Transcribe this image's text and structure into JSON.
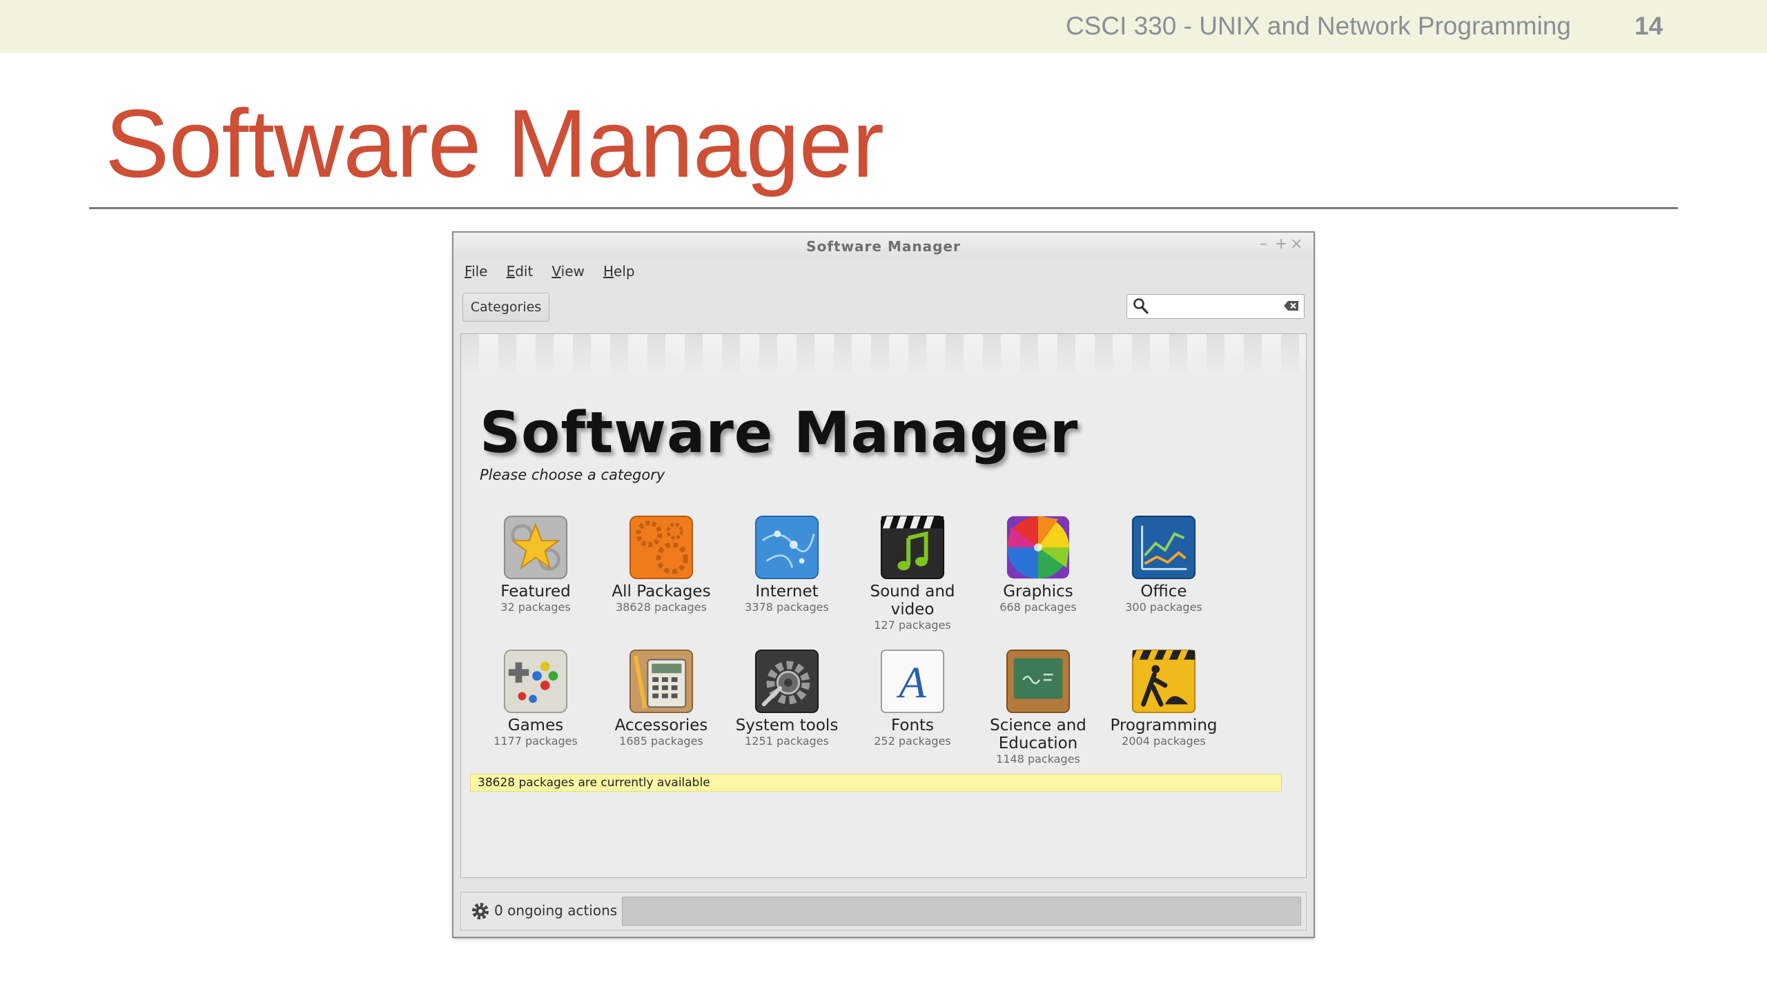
{
  "slide": {
    "course_title": "CSCI 330 - UNIX and Network Programming",
    "slide_number": "14",
    "title": "Software Manager"
  },
  "window": {
    "title": "Software Manager",
    "controls": {
      "minimize": "–",
      "maximize": "+",
      "close": "×"
    },
    "menu": [
      "File",
      "Edit",
      "View",
      "Help"
    ],
    "categories_button": "Categories",
    "search": {
      "value": "",
      "placeholder": ""
    }
  },
  "main": {
    "heading": "Software Manager",
    "subheading": "Please choose a category",
    "categories": [
      {
        "label": "Featured",
        "count": "32 packages",
        "icon": "featured-star-icon"
      },
      {
        "label": "All Packages",
        "count": "38628 packages",
        "icon": "all-packages-gears-icon"
      },
      {
        "label": "Internet",
        "count": "3378 packages",
        "icon": "internet-globe-icon"
      },
      {
        "label": "Sound and video",
        "count": "127 packages",
        "icon": "sound-video-clapper-icon"
      },
      {
        "label": "Graphics",
        "count": "668 packages",
        "icon": "graphics-color-wheel-icon"
      },
      {
        "label": "Office",
        "count": "300 packages",
        "icon": "office-chart-icon"
      },
      {
        "label": "Games",
        "count": "1177 packages",
        "icon": "games-gamepad-icon"
      },
      {
        "label": "Accessories",
        "count": "1685 packages",
        "icon": "accessories-calculator-icon"
      },
      {
        "label": "System tools",
        "count": "1251 packages",
        "icon": "system-tools-gear-icon"
      },
      {
        "label": "Fonts",
        "count": "252 packages",
        "icon": "fonts-letter-a-icon"
      },
      {
        "label": "Science and Education",
        "count": "1148 packages",
        "icon": "science-blackboard-icon"
      },
      {
        "label": "Programming",
        "count": "2004 packages",
        "icon": "programming-construction-icon"
      }
    ],
    "status": "38628 packages are currently available"
  },
  "footer": {
    "ongoing_actions": "0 ongoing actions",
    "progress": 0
  },
  "colors": {
    "slide_title": "#cd4f36",
    "header_band": "#f2f3df",
    "status_banner": "#fbf7a4"
  }
}
